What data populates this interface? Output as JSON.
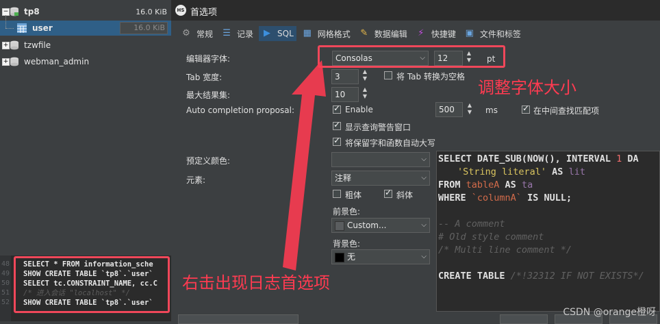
{
  "tree": {
    "db": {
      "name": "tp8",
      "size": "16.0 KiB"
    },
    "table": {
      "name": "user",
      "size": "16.0 KiB"
    },
    "others": [
      {
        "name": "tzwfile"
      },
      {
        "name": "webman_admin"
      }
    ]
  },
  "log": [
    {
      "num": "48",
      "text": "SELECT * FROM information_sche"
    },
    {
      "num": "49",
      "text": "SHOW CREATE TABLE `tp8`.`user`"
    },
    {
      "num": "50",
      "text": "SELECT tc.CONSTRAINT_NAME, cc.C"
    },
    {
      "num": "51",
      "text": "/* 进入会话 \"localhost\" */"
    },
    {
      "num": "52",
      "text": "SHOW CREATE TABLE `tp8`.`user`"
    }
  ],
  "dialog": {
    "title": "首选项",
    "tabs": [
      {
        "label": "常规",
        "icon": "gear-icon"
      },
      {
        "label": "记录",
        "icon": "list-icon"
      },
      {
        "label": "SQL",
        "icon": "play-icon"
      },
      {
        "label": "网格格式",
        "icon": "grid-icon"
      },
      {
        "label": "数据编辑",
        "icon": "edit-icon"
      },
      {
        "label": "快捷键",
        "icon": "lightning-icon"
      },
      {
        "label": "文件和标签",
        "icon": "save-icon"
      }
    ],
    "font_label": "编辑器字体:",
    "font_value": "Consolas",
    "font_size": "12",
    "font_unit": "pt",
    "tab_width_label": "Tab 宽度:",
    "tab_width": "3",
    "tab_to_space": "将 Tab 转换为空格",
    "max_results_label": "最大结果集:",
    "max_results": "10",
    "auto_label": "Auto completion proposal:",
    "enable": "Enable",
    "delay": "500",
    "delay_unit": "ms",
    "middle_search": "在中间查找匹配项",
    "show_warning": "显示查询警告窗口",
    "uppercase": "将保留字和函数自动大写",
    "preset_label": "预定义颜色:",
    "preset_value": "",
    "element_label": "元素:",
    "element_value": "注释",
    "bold": "粗体",
    "italic": "斜体",
    "fg_label": "前景色:",
    "fg_value": "Custom...",
    "bg_label": "背景色:",
    "bg_value": "无"
  },
  "preview": {
    "l1_a": "SELECT DATE_SUB(NOW(), INTERVAL ",
    "l1_num": "1",
    "l1_b": " DA",
    "l2_str": "'String literal'",
    "l2_as": " AS ",
    "l2_id": "lit",
    "l3_from": "FROM ",
    "l3_tbl": "tableA",
    "l3_as": " AS ",
    "l3_id": "ta",
    "l4_where": "WHERE ",
    "l4_col": "`columnA`",
    "l4_rest": " IS NULL;",
    "c1": "-- A comment",
    "c2": "# Old style comment",
    "c3": "/* Multi line comment */",
    "l8_a": "CREATE TABLE ",
    "l8_c": "/*!32312 IF NOT EXISTS*/"
  },
  "annotations": {
    "font_note": "调整字体大小",
    "log_note": "右击出现日志首选项"
  },
  "watermark": "CSDN @orange橙呀",
  "colors": {
    "accent": "#2f5f87",
    "annotation": "#ff3b51"
  }
}
